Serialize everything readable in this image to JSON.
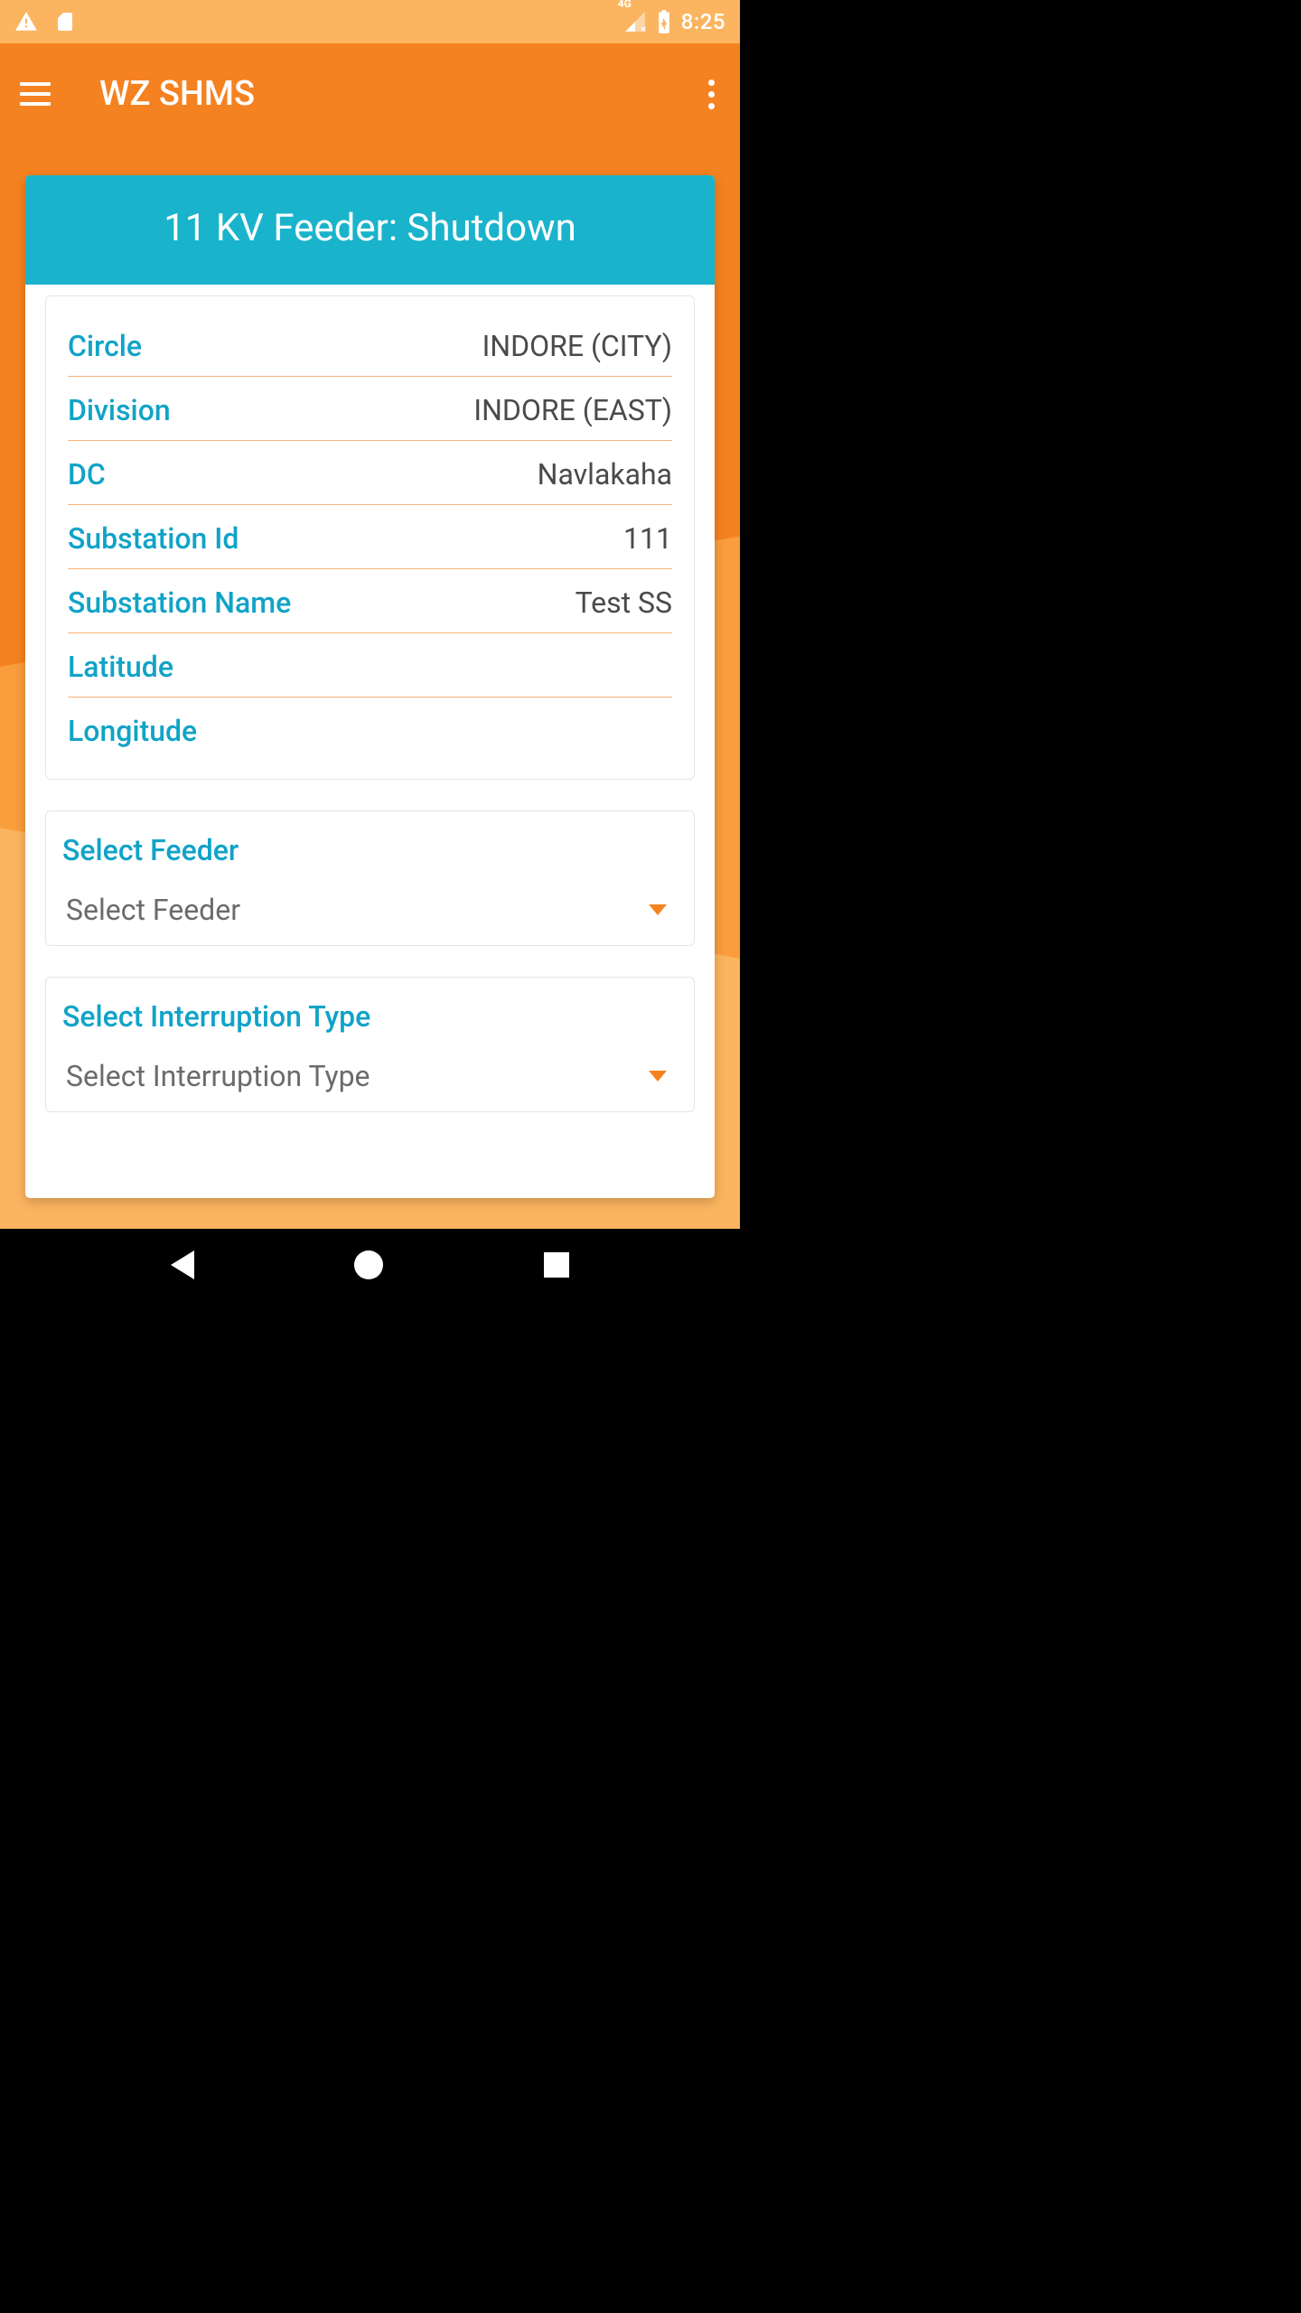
{
  "status": {
    "network_badge": "4G",
    "time": "8:25"
  },
  "appbar": {
    "title": "WZ SHMS"
  },
  "card": {
    "header": "11 KV Feeder: Shutdown",
    "fields": {
      "circle": {
        "label": "Circle",
        "value": "INDORE (CITY)"
      },
      "division": {
        "label": "Division",
        "value": "INDORE (EAST)"
      },
      "dc": {
        "label": "DC",
        "value": "Navlakaha"
      },
      "substation_id": {
        "label": "Substation Id",
        "value": "111"
      },
      "substation_name": {
        "label": "Substation Name",
        "value": "Test SS"
      },
      "latitude": {
        "label": "Latitude",
        "value": ""
      },
      "longitude": {
        "label": "Longitude",
        "value": ""
      }
    }
  },
  "feeder": {
    "label": "Select Feeder",
    "selected": "Select Feeder"
  },
  "interruption": {
    "label": "Select Interruption Type",
    "selected": "Select Interruption Type"
  }
}
